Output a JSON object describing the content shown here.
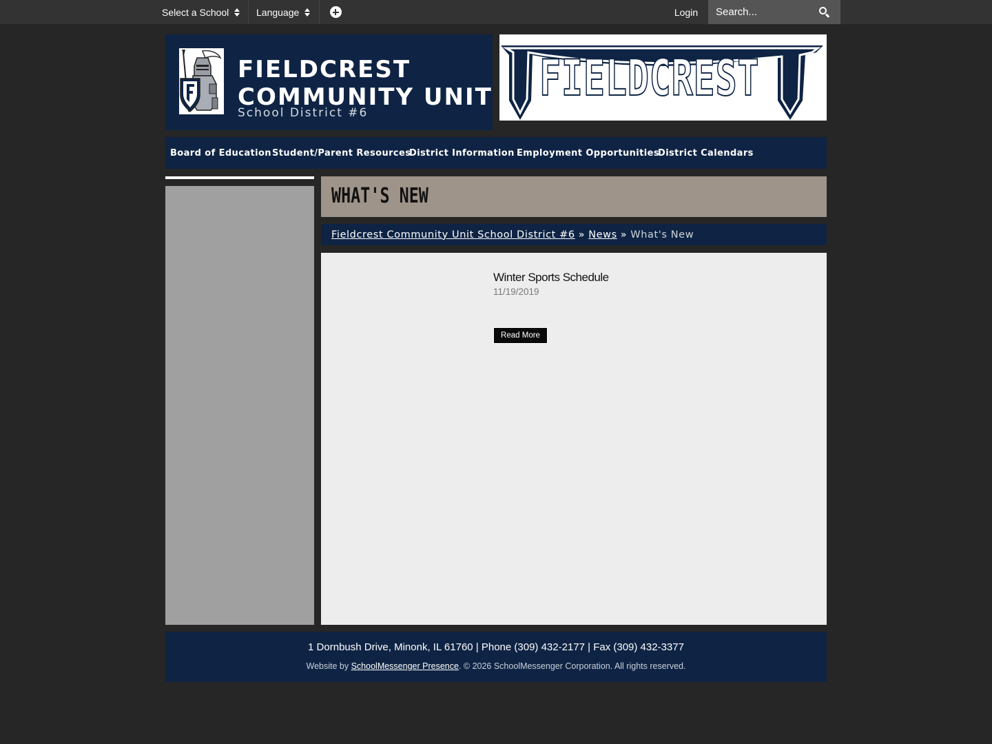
{
  "topbar": {
    "select_school_label": "Select a School",
    "language_label": "Language",
    "login_label": "Login",
    "search_placeholder": "Search..."
  },
  "header": {
    "name_line_1": "FIELDCREST",
    "name_line_2": "COMMUNITY UNIT",
    "subtitle": "School District #6",
    "banner_text": "FIELDCREST"
  },
  "nav": {
    "items": [
      "Board of Education",
      "Student/Parent Resources",
      "District Information",
      "Employment Opportunities",
      "District Calendars"
    ]
  },
  "page": {
    "title": "WHAT'S NEW"
  },
  "breadcrumb": {
    "home": "Fieldcrest Community Unit School District #6",
    "separator": "»",
    "section": "News",
    "current": "What's New"
  },
  "news": {
    "items": [
      {
        "title": "Winter Sports Schedule",
        "date": "11/19/2019",
        "button_label": "Read More"
      }
    ]
  },
  "footer": {
    "address_line": "1 Dornbush Drive, Minonk, IL 61760 | Phone (309) 432-2177 | Fax (309) 432-3377",
    "credit_prefix": "Website by",
    "credit_link": "SchoolMessenger Presence",
    "credit_suffix": ". © 2026 SchoolMessenger Corporation. All rights reserved."
  },
  "colors": {
    "navy": "#0f2444",
    "page_background": "#262626",
    "topbar": "#333333",
    "title_bar": "#9f948a",
    "sidebar": "#a0a0a0",
    "content": "#ededed"
  }
}
